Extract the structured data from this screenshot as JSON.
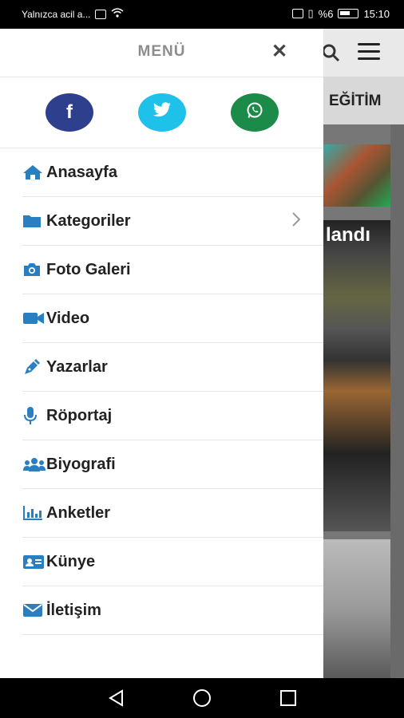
{
  "status_bar": {
    "notification_text": "Yalnızca acil a...",
    "battery_text": "%6",
    "time": "15:10"
  },
  "background": {
    "nav_label": "EĞİTİM",
    "caption": "landı"
  },
  "drawer": {
    "title": "MENÜ",
    "close_icon": "close-icon",
    "socials": [
      {
        "name": "facebook",
        "glyph": "f",
        "color": "#2d3f8d"
      },
      {
        "name": "twitter",
        "color": "#1ec1ea"
      },
      {
        "name": "whatsapp",
        "color": "#1c8b4a"
      }
    ],
    "items": [
      {
        "label": "Anasayfa",
        "icon": "home-icon"
      },
      {
        "label": "Kategoriler",
        "icon": "folder-icon",
        "has_chevron": true
      },
      {
        "label": "Foto Galeri",
        "icon": "camera-icon"
      },
      {
        "label": "Video",
        "icon": "video-icon"
      },
      {
        "label": "Yazarlar",
        "icon": "pen-icon"
      },
      {
        "label": "Röportaj",
        "icon": "microphone-icon"
      },
      {
        "label": "Biyografi",
        "icon": "users-icon"
      },
      {
        "label": "Anketler",
        "icon": "chart-icon"
      },
      {
        "label": "Künye",
        "icon": "id-card-icon"
      },
      {
        "label": "İletişim",
        "icon": "envelope-icon"
      }
    ],
    "icon_color": "#2a7fc0"
  }
}
